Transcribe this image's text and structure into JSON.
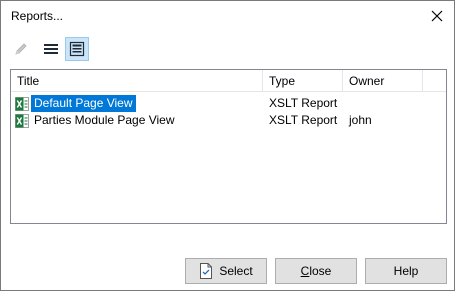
{
  "window": {
    "title": "Reports..."
  },
  "toolbar": {
    "items": [
      {
        "icon": "pencil-edit-icon",
        "enabled": false
      },
      {
        "icon": "list-view-icon",
        "enabled": true
      },
      {
        "icon": "details-view-icon",
        "enabled": true,
        "active": true
      }
    ]
  },
  "list": {
    "columns": [
      "Title",
      "Type",
      "Owner"
    ],
    "rows": [
      {
        "title": "Default Page View",
        "type": "XSLT Report",
        "owner": "",
        "icon": "xslt-report-icon",
        "selected": true
      },
      {
        "title": "Parties Module Page View",
        "type": "XSLT Report",
        "owner": "john",
        "icon": "xslt-report-icon",
        "selected": false
      }
    ]
  },
  "buttons": {
    "select": "Select",
    "close_first": "C",
    "close_rest": "lose",
    "help": "Help"
  },
  "colors": {
    "selection": "#0078d7",
    "excel_green": "#1d7a3e",
    "button_face": "#e1e1e1"
  }
}
